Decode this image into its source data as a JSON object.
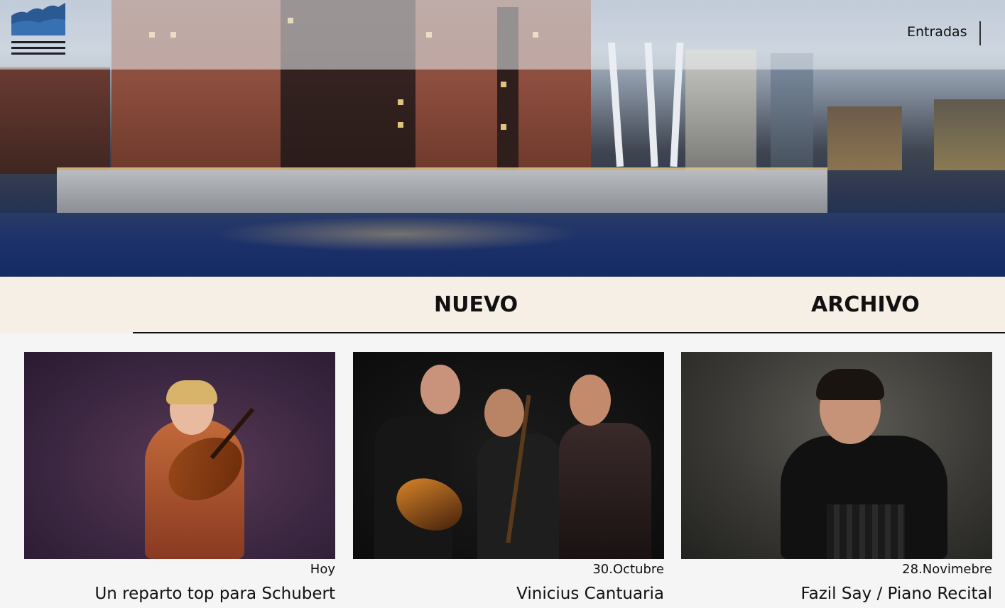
{
  "header": {
    "logo_name": "elbphilharmonie-logo",
    "nav_tickets_label": "Entradas"
  },
  "tabs": [
    {
      "label": "NUEVO",
      "active": true
    },
    {
      "label": "ARCHIVO",
      "active": false
    }
  ],
  "events": [
    {
      "date": "Hoy",
      "title": "Un reparto top para Schubert"
    },
    {
      "date": "30.Octubre",
      "title": "Vinicius Cantuaria"
    },
    {
      "date": "28.Novimebre",
      "title": "Fazil Say / Piano Recital"
    }
  ],
  "colors": {
    "tab_bar_background": "#f6efe6",
    "page_background": "#f5f5f5",
    "text": "#111111"
  }
}
